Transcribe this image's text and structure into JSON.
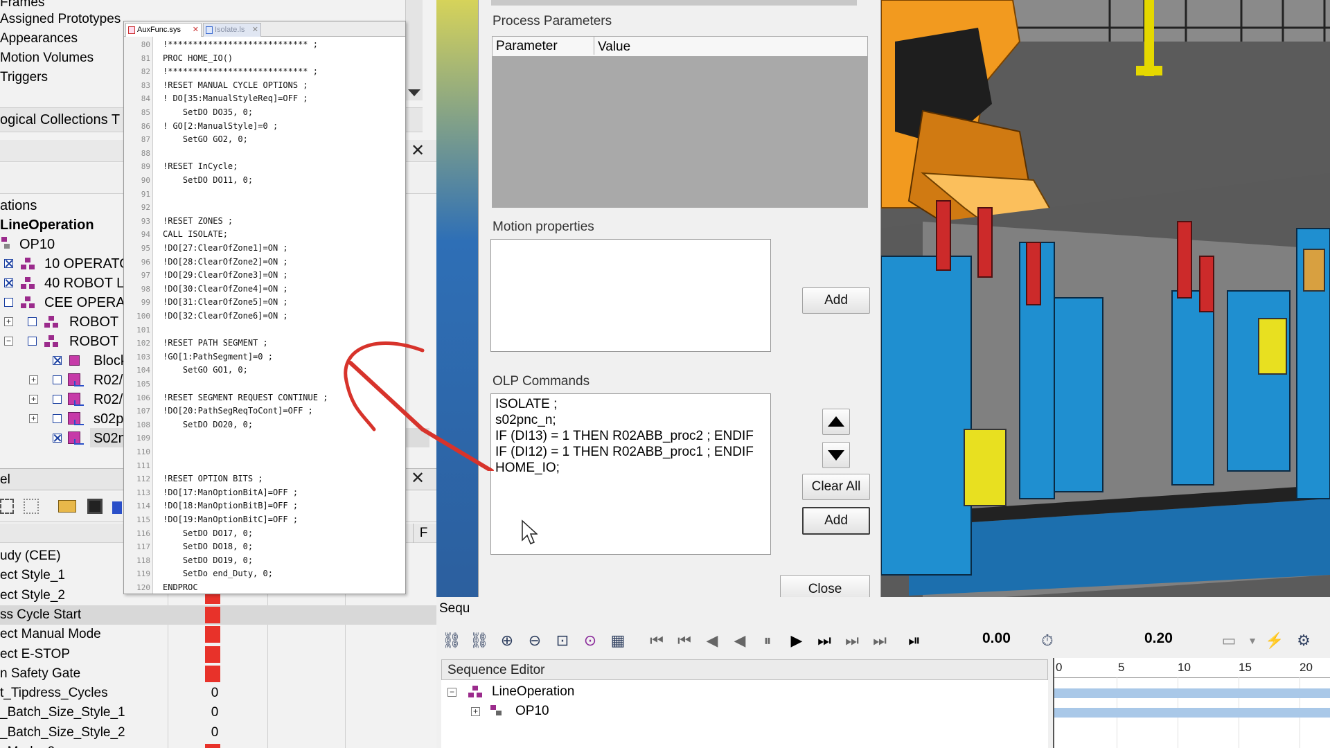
{
  "navigation": {
    "items": [
      "Frames",
      "Assigned Prototypes",
      "Appearances",
      "Motion Volumes",
      "Triggers"
    ],
    "logical_collections_title": "ogical Collections T"
  },
  "operations_tree": {
    "header": "ations",
    "root": "LineOperation",
    "nodes": [
      {
        "label": "OP10"
      },
      {
        "label": "10 OPERATO"
      },
      {
        "label": "40 ROBOT L"
      },
      {
        "label": "CEE OPERA"
      },
      {
        "label": "ROBOT I"
      },
      {
        "label": "ROBOT I"
      },
      {
        "label": "Block"
      },
      {
        "label": "R02/"
      },
      {
        "label": "R02/"
      },
      {
        "label": "s02p"
      },
      {
        "label": "S02n"
      }
    ]
  },
  "signal_panel": {
    "title": "el",
    "f_label": "F",
    "rows": [
      {
        "name": "udy (CEE)",
        "value": ""
      },
      {
        "name": "ect Style_1",
        "value": "",
        "red": true
      },
      {
        "name": "ect Style_2",
        "value": "",
        "red": true
      },
      {
        "name": "ss Cycle Start",
        "value": "",
        "red": true
      },
      {
        "name": "ect Manual Mode",
        "value": "",
        "red": true
      },
      {
        "name": "ect E-STOP",
        "value": "",
        "red": true
      },
      {
        "name": "n Safety Gate",
        "value": "",
        "red": true
      },
      {
        "name": "t_Tipdress_Cycles",
        "value": "0"
      },
      {
        "name": "_Batch_Size_Style_1",
        "value": "0"
      },
      {
        "name": "_Batch_Size_Style_2",
        "value": "0"
      },
      {
        "name": "_Mode_0",
        "value": "",
        "red": true
      }
    ]
  },
  "editor": {
    "tabs": [
      {
        "label": "AuxFunc.sys",
        "active": true
      },
      {
        "label": "Isolate.ls",
        "active": false
      }
    ],
    "lines": [
      {
        "n": "80",
        "t": "!**************************** ;"
      },
      {
        "n": "81",
        "t": "PROC HOME_IO()"
      },
      {
        "n": "82",
        "t": "!**************************** ;"
      },
      {
        "n": "83",
        "t": "!RESET MANUAL CYCLE OPTIONS ;"
      },
      {
        "n": "84",
        "t": "! DO[35:ManualStyleReq]=OFF ;"
      },
      {
        "n": "85",
        "t": "    SetDO DO35, 0;"
      },
      {
        "n": "86",
        "t": "! GO[2:ManualStyle]=0 ;"
      },
      {
        "n": "87",
        "t": "    SetGO GO2, 0;"
      },
      {
        "n": "88",
        "t": ""
      },
      {
        "n": "89",
        "t": "!RESET InCycle;"
      },
      {
        "n": "90",
        "t": "    SetDO DO11, 0;"
      },
      {
        "n": "91",
        "t": ""
      },
      {
        "n": "92",
        "t": ""
      },
      {
        "n": "93",
        "t": "!RESET ZONES ;"
      },
      {
        "n": "94",
        "t": "CALL ISOLATE;"
      },
      {
        "n": "95",
        "t": "!DO[27:ClearOfZone1]=ON ;"
      },
      {
        "n": "96",
        "t": "!DO[28:ClearOfZone2]=ON ;"
      },
      {
        "n": "97",
        "t": "!DO[29:ClearOfZone3]=ON ;"
      },
      {
        "n": "98",
        "t": "!DO[30:ClearOfZone4]=ON ;"
      },
      {
        "n": "99",
        "t": "!DO[31:ClearOfZone5]=ON ;"
      },
      {
        "n": "100",
        "t": "!DO[32:ClearOfZone6]=ON ;"
      },
      {
        "n": "101",
        "t": ""
      },
      {
        "n": "102",
        "t": "!RESET PATH SEGMENT ;"
      },
      {
        "n": "103",
        "t": "!GO[1:PathSegment]=0 ;"
      },
      {
        "n": "104",
        "t": "    SetGO GO1, 0;"
      },
      {
        "n": "105",
        "t": ""
      },
      {
        "n": "106",
        "t": "!RESET SEGMENT REQUEST CONTINUE ;"
      },
      {
        "n": "107",
        "t": "!DO[20:PathSegReqToCont]=OFF ;"
      },
      {
        "n": "108",
        "t": "    SetDO DO20, 0;"
      },
      {
        "n": "109",
        "t": ""
      },
      {
        "n": "110",
        "t": ""
      },
      {
        "n": "111",
        "t": ""
      },
      {
        "n": "112",
        "t": "!RESET OPTION BITS ;"
      },
      {
        "n": "113",
        "t": "!DO[17:ManOptionBitA]=OFF ;"
      },
      {
        "n": "114",
        "t": "!DO[18:ManOptionBitB]=OFF ;"
      },
      {
        "n": "115",
        "t": "!DO[19:ManOptionBitC]=OFF ;"
      },
      {
        "n": "116",
        "t": "    SetDO DO17, 0;"
      },
      {
        "n": "117",
        "t": "    SetDO DO18, 0;"
      },
      {
        "n": "118",
        "t": "    SetDO DO19, 0;"
      },
      {
        "n": "119",
        "t": "    SetDo end_Duty, 0;"
      },
      {
        "n": "120",
        "t": "ENDPROC"
      }
    ]
  },
  "dialog": {
    "process_parameters_label": "Process Parameters",
    "param_col": "Parameter",
    "value_col": "Value",
    "motion_properties_label": "Motion properties",
    "add_label": "Add",
    "olp_commands_label": "OLP Commands",
    "olp_commands": [
      "ISOLATE ;",
      "s02pnc_n;",
      "IF (DI13) = 1 THEN R02ABB_proc2 ; ENDIF",
      "IF (DI12) = 1 THEN R02ABB_proc1 ; ENDIF",
      "HOME_IO;"
    ],
    "clear_all_label": "Clear All",
    "add2_label": "Add",
    "close_label": "Close"
  },
  "sequence": {
    "panel_title": "Sequ",
    "time_value": "0.00",
    "time_step": "0.20",
    "editor_title": "Sequence Editor",
    "tree": [
      {
        "label": "LineOperation"
      },
      {
        "label": "OP10"
      }
    ],
    "ticks": [
      "0",
      "5",
      "10",
      "15",
      "20"
    ]
  },
  "colors": {
    "accent_red": "#e8322a",
    "annotation_arrow": "#d7332b",
    "robot_orange": "#f29a1f",
    "fixture_blue": "#1f8fd0"
  }
}
